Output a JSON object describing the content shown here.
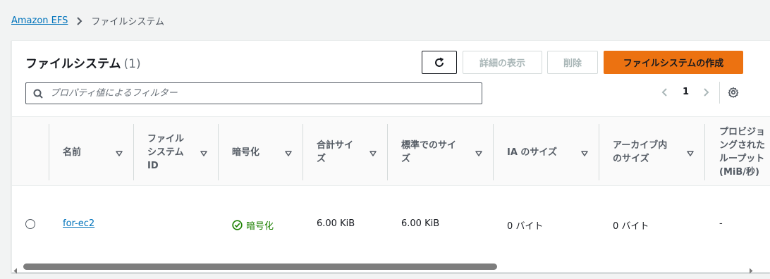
{
  "breadcrumb": {
    "root": "Amazon EFS",
    "current": "ファイルシステム"
  },
  "panel": {
    "title": "ファイルシステム",
    "count": "(1)",
    "buttons": {
      "details": "詳細の表示",
      "delete": "削除",
      "create": "ファイルシステムの作成"
    },
    "filter_placeholder": "プロパティ値によるフィルター",
    "page": "1"
  },
  "table": {
    "columns": [
      {
        "label": "名前"
      },
      {
        "label": "ファイル\nシステム\nID"
      },
      {
        "label": "暗号化"
      },
      {
        "label": "合計サイ\nズ"
      },
      {
        "label": "標準でのサイ\nズ"
      },
      {
        "label": "IA のサイズ"
      },
      {
        "label": "アーカイブ内\nのサイズ"
      },
      {
        "label": "プロビジョ\nングされた\nループット\n(MiB/秒)"
      }
    ],
    "rows": [
      {
        "name": "for-ec2",
        "fs_id": "",
        "encryption": "暗号化",
        "total_size": "6.00 KiB",
        "standard_size": "6.00 KiB",
        "ia_size": "0 バイト",
        "archive_size": "0 バイト",
        "throughput": "-"
      }
    ]
  },
  "colors": {
    "accent": "#ec7211",
    "link": "#0073bb",
    "success": "#1d8102"
  }
}
